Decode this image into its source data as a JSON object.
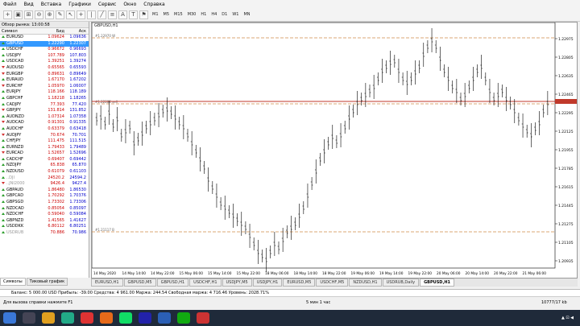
{
  "menu": [
    "Файл",
    "Вид",
    "Вставка",
    "Графики",
    "Сервис",
    "Окно",
    "Справка"
  ],
  "timeframes": [
    "M1",
    "M5",
    "M15",
    "M30",
    "H1",
    "H4",
    "D1",
    "W1",
    "MN"
  ],
  "market_watch": {
    "title": "Обзор рынка: 13:00:58",
    "headers": {
      "symbol": "Символ",
      "bid": "Бид",
      "ask": "Аск"
    },
    "rows": [
      {
        "symbol": "EURUSD",
        "bid": "1.09624",
        "ask": "1.09636",
        "dir": "up"
      },
      {
        "symbol": "GBPUSD",
        "bid": "1.22290",
        "ask": "1.22307",
        "dir": "up",
        "selected": true
      },
      {
        "symbol": "USDCHF",
        "bid": "0.96672",
        "ask": "0.96693",
        "dir": "up"
      },
      {
        "symbol": "USDJPY",
        "bid": "107.789",
        "ask": "107.803",
        "dir": "up"
      },
      {
        "symbol": "USDCAD",
        "bid": "1.39251",
        "ask": "1.39274",
        "dir": "up"
      },
      {
        "symbol": "AUDUSD",
        "bid": "0.65565",
        "ask": "0.65593",
        "dir": "down"
      },
      {
        "symbol": "EURGBP",
        "bid": "0.89631",
        "ask": "0.89649",
        "dir": "down"
      },
      {
        "symbol": "EURAUD",
        "bid": "1.67170",
        "ask": "1.67202",
        "dir": "up"
      },
      {
        "symbol": "EURCHF",
        "bid": "1.05970",
        "ask": "1.06007",
        "dir": "down"
      },
      {
        "symbol": "EURJPY",
        "bid": "118.166",
        "ask": "118.189",
        "dir": "up"
      },
      {
        "symbol": "GBPCHF",
        "bid": "1.18218",
        "ask": "1.18265",
        "dir": "up"
      },
      {
        "symbol": "CADJPY",
        "bid": "77.393",
        "ask": "77.420",
        "dir": "up"
      },
      {
        "symbol": "GBPJPY",
        "bid": "131.814",
        "ask": "131.852",
        "dir": "down"
      },
      {
        "symbol": "AUDNZD",
        "bid": "1.07314",
        "ask": "1.07358",
        "dir": "up"
      },
      {
        "symbol": "AUDCAD",
        "bid": "0.91301",
        "ask": "0.91335",
        "dir": "down"
      },
      {
        "symbol": "AUDCHF",
        "bid": "0.63379",
        "ask": "0.63418",
        "dir": "up"
      },
      {
        "symbol": "AUDJPY",
        "bid": "70.674",
        "ask": "70.701",
        "dir": "down"
      },
      {
        "symbol": "CHFJPY",
        "bid": "111.475",
        "ask": "111.515",
        "dir": "up"
      },
      {
        "symbol": "EURNZD",
        "bid": "1.79433",
        "ask": "1.79489",
        "dir": "up"
      },
      {
        "symbol": "EURCAD",
        "bid": "1.52657",
        "ask": "1.52696",
        "dir": "down"
      },
      {
        "symbol": "CADCHF",
        "bid": "0.69407",
        "ask": "0.69442",
        "dir": "up"
      },
      {
        "symbol": "NZDJPY",
        "bid": "65.838",
        "ask": "65.870",
        "dir": "up"
      },
      {
        "symbol": "NZDUSD",
        "bid": "0.61079",
        "ask": "0.61103",
        "dir": "up"
      },
      {
        "symbol": "..DJI",
        "bid": "24520.2",
        "ask": "24594.2",
        "dir": "up",
        "muted": true
      },
      {
        "symbol": "..JNI2000",
        "bid": "9426.4",
        "ask": "9427.4",
        "dir": "down",
        "muted": true
      },
      {
        "symbol": "GBPAUD",
        "bid": "1.86480",
        "ask": "1.86530",
        "dir": "up"
      },
      {
        "symbol": "GBPCAD",
        "bid": "1.70292",
        "ask": "1.70376",
        "dir": "up"
      },
      {
        "symbol": "GBPSGD",
        "bid": "1.73302",
        "ask": "1.73306",
        "dir": "up"
      },
      {
        "symbol": "NZDCAD",
        "bid": "0.85054",
        "ask": "0.85097",
        "dir": "up"
      },
      {
        "symbol": "NZDCHF",
        "bid": "0.59040",
        "ask": "0.59084",
        "dir": "up"
      },
      {
        "symbol": "GBPNZD",
        "bid": "1.41565",
        "ask": "1.41627",
        "dir": "up"
      },
      {
        "symbol": "USDDKK",
        "bid": "6.80112",
        "ask": "6.80251",
        "dir": "up"
      },
      {
        "symbol": "USDRUB",
        "bid": "70.886",
        "ask": "70.986",
        "dir": "up",
        "muted": true
      }
    ],
    "tabs": [
      "Символы",
      "Тиковый график"
    ]
  },
  "chart": {
    "title": "GBPUSD,H1",
    "level_labels": [
      "#1.22970 W",
      "#1.22280 sell",
      "#1.21117 B"
    ],
    "y_ticks": [
      "1.22975",
      "1.22805",
      "1.22635",
      "1.22465",
      "1.22295",
      "1.22125",
      "1.21955",
      "1.21785",
      "1.21615",
      "1.21445",
      "1.21275",
      "1.21105",
      "1.20935"
    ],
    "x_ticks": [
      "14 May 2020",
      "14 May 14:00",
      "14 May 22:00",
      "15 May 06:00",
      "15 May 14:00",
      "15 May 22:00",
      "18 May 06:00",
      "18 May 14:00",
      "18 May 22:00",
      "19 May 06:00",
      "19 May 14:00",
      "19 May 22:00",
      "20 May 06:00",
      "20 May 14:00",
      "20 May 22:00",
      "21 May 06:00"
    ],
    "colors": {
      "bg": "#ffffff",
      "candle": "#000000",
      "level": "#d08a4a",
      "price_line": "#c0392b"
    }
  },
  "chart_tabs": [
    "EURUSD,H1",
    "GBPUSD,M5",
    "GBPUSD,H1",
    "USDCHF,H1",
    "USDJPY,M5",
    "USDJPY,H1",
    "EURUSD,M5",
    "USDCHF,M5",
    "NZDUSD,H1",
    "USDRUB,Daily",
    "GBPUSD,H1"
  ],
  "account": "Баланс: 5 000.00 USD  Прибыль: -39.00  Средства: 4 961.00  Маржа: 244.54  Свободная маржа: 4 716.46  Уровень: 2028.71%",
  "status": {
    "help": "Для вызова справки нажмите F1",
    "profile": "5 мин 1 час",
    "traffic": "10777/17 kb"
  }
}
